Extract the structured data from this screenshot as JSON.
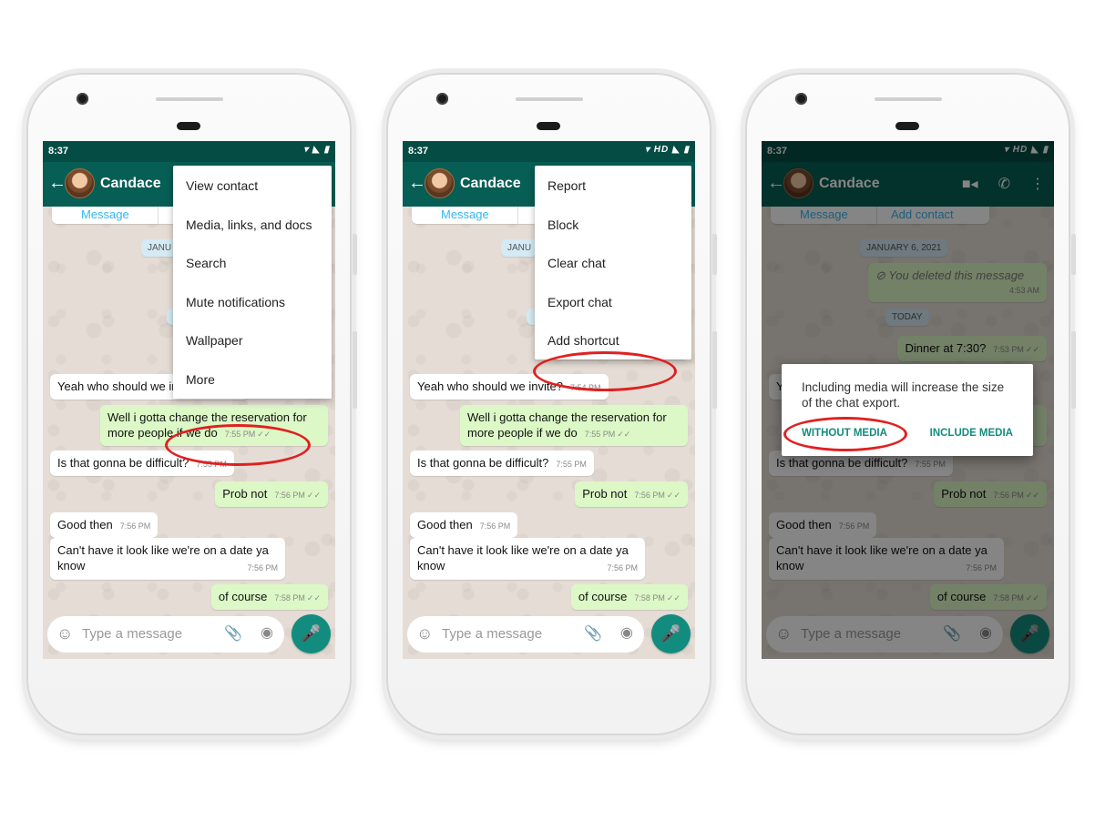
{
  "phones": [
    {
      "status_time": "8:37",
      "status_icons": "▾ ◣ ▮",
      "contact_name": "Candace",
      "menu": [
        "View contact",
        "Media, links, and docs",
        "Search",
        "Mute notifications",
        "Wallpaper",
        "More"
      ],
      "highlighted_item": "More"
    },
    {
      "status_time": "8:37",
      "status_icons": "▾ HD ◣ ▮",
      "contact_name": "Candace",
      "menu": [
        "Report",
        "Block",
        "Clear chat",
        "Export chat",
        "Add shortcut"
      ],
      "highlighted_item": "Export chat"
    },
    {
      "status_time": "8:37",
      "status_icons": "▾ HD ◣ ▮",
      "contact_name": "Candace",
      "dialog": {
        "message": "Including media will increase the size of the chat export.",
        "without_media": "WITHOUT MEDIA",
        "include_media": "INCLUDE MEDIA"
      },
      "highlighted_item": "WITHOUT MEDIA"
    }
  ],
  "chat": {
    "buttons": {
      "message": "Message",
      "add_contact": "Add contact"
    },
    "date_chip_1": "JANUARY 6, 2021",
    "date_chip_1_short": "JANU",
    "deleted_text": "You deleted this message",
    "deleted_time": "4:53 AM",
    "date_chip_2": "TODAY",
    "messages": [
      {
        "text": "Dinner at 7:30?",
        "time": "7:53 PM",
        "dir": "out"
      },
      {
        "text": "Yeah who should we invite?",
        "time": "7:54 PM",
        "dir": "in"
      },
      {
        "text": "Well i gotta change the reservation for more people if we do",
        "time": "7:55 PM",
        "dir": "out"
      },
      {
        "text": "Is that gonna be difficult?",
        "time": "7:55 PM",
        "dir": "in"
      },
      {
        "text": "Prob not",
        "time": "7:56 PM",
        "dir": "out"
      },
      {
        "text": "Good then",
        "time": "7:56 PM",
        "dir": "in"
      },
      {
        "text": "Can't have it look like we're on a date ya know",
        "time": "7:56 PM",
        "dir": "in"
      },
      {
        "text": "of course",
        "time": "7:58 PM",
        "dir": "out"
      }
    ],
    "input_placeholder": "Type a message",
    "ticks": "✓✓"
  },
  "icons": {
    "back": "back-arrow-icon",
    "video": "video-camera-icon",
    "call": "phone-icon",
    "more": "more-vert-icon",
    "emoji": "emoji-icon",
    "attach": "paperclip-icon",
    "camera": "camera-icon",
    "mic": "microphone-icon"
  },
  "colors": {
    "header": "#075e54",
    "status_bar": "#054d44",
    "outgoing_bubble": "#dcf8c6",
    "accent": "#128c7e",
    "highlight_ring": "#e02020"
  }
}
